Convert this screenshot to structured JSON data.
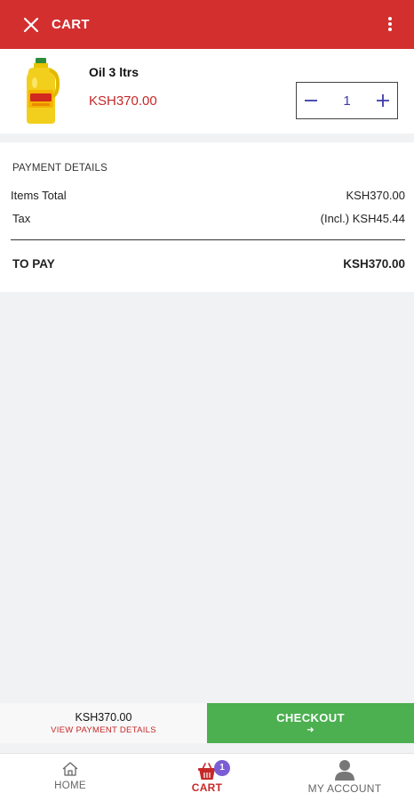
{
  "header": {
    "title": "CART",
    "close_icon": "close-icon",
    "menu_icon": "more-vertical-icon",
    "color": "#d32f2f"
  },
  "cart_items": [
    {
      "name": "Oil 3 ltrs",
      "price": "KSH370.00",
      "quantity": "1",
      "image": "oil-bottle-image"
    }
  ],
  "payment_details": {
    "heading": "PAYMENT DETAILS",
    "items_total_label": "Items Total",
    "items_total_value": "KSH370.00",
    "tax_label": "Tax",
    "tax_value": "(Incl.) KSH45.44",
    "to_pay_label": "TO PAY",
    "to_pay_value": "KSH370.00"
  },
  "bottom_bar": {
    "total": "KSH370.00",
    "view_details_label": "VIEW PAYMENT DETAILS",
    "checkout_label": "CHECKOUT",
    "checkout_color": "#4caf50"
  },
  "nav": {
    "home_label": "HOME",
    "cart_label": "CART",
    "cart_badge": "1",
    "account_label": "MY ACCOUNT",
    "active_color": "#c62828"
  }
}
